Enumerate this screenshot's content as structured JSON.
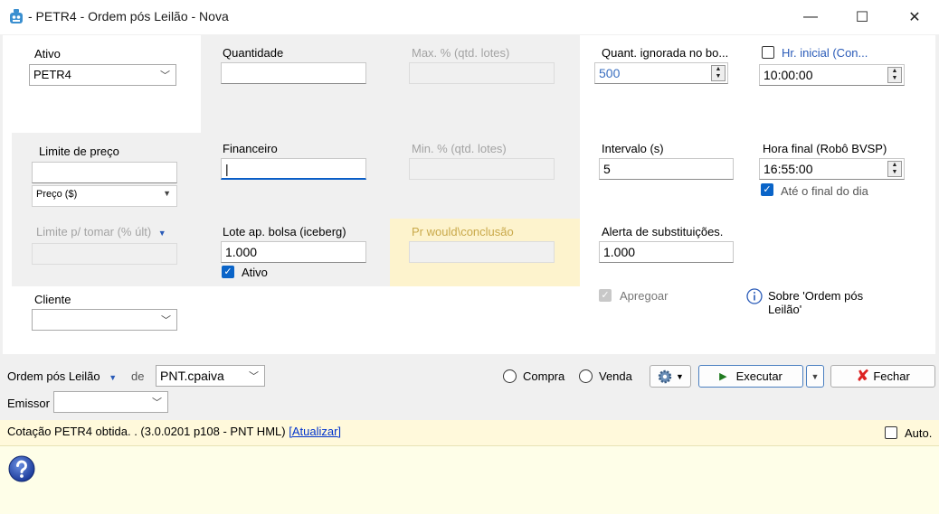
{
  "window": {
    "title": "- PETR4 - Ordem pós Leilão - Nova",
    "minimize_glyph": "—",
    "maximize_glyph": "☐",
    "close_glyph": "✕",
    "app_icon": "robot-icon"
  },
  "form": {
    "ativo": {
      "label": "Ativo",
      "value": "PETR4"
    },
    "quantidade": {
      "label": "Quantidade",
      "value": ""
    },
    "max_pct": {
      "label": "Max. % (qtd. lotes)",
      "value": ""
    },
    "quant_ignorada": {
      "label": "Quant. ignorada no bo...",
      "value": "500"
    },
    "hr_inicial": {
      "label": "Hr. inicial (Con...",
      "value": "10:00:00",
      "checked": false
    },
    "limite_preco": {
      "label": "Limite de preço",
      "value": "",
      "type_value": "Preço ($)"
    },
    "financeiro": {
      "label": "Financeiro",
      "value": "|"
    },
    "min_pct": {
      "label": "Min. % (qtd. lotes)",
      "value": ""
    },
    "intervalo": {
      "label": "Intervalo (s)",
      "value": "5"
    },
    "hora_final": {
      "label": "Hora final (Robô BVSP)",
      "value": "16:55:00"
    },
    "ate_final": {
      "label": "Até o final do dia",
      "checked": true
    },
    "limite_tomar": {
      "label": "Limite p/ tomar (% últ)",
      "value": ""
    },
    "lote_bolsa": {
      "label": "Lote ap. bolsa (iceberg)",
      "value": "1.000"
    },
    "ativo_check": {
      "label": "Ativo",
      "checked": true
    },
    "pr_would": {
      "label": "Pr would\\conclusão",
      "value": ""
    },
    "alerta": {
      "label": "Alerta de substituições.",
      "value": "1.000"
    },
    "apregoar": {
      "label": "Apregoar",
      "checked": true
    },
    "sobre": {
      "label": "Sobre 'Ordem pós Leilão'"
    },
    "cliente": {
      "label": "Cliente",
      "value": ""
    }
  },
  "bottom": {
    "tipo": "Ordem pós Leilão",
    "de_label": "de",
    "conta": "PNT.cpaiva",
    "compra": "Compra",
    "venda": "Venda",
    "executar": "Executar",
    "fechar": "Fechar",
    "emissor_label": "Emissor",
    "emissor_value": ""
  },
  "status": {
    "text": "Cotação PETR4 obtida. .  (3.0.0201 p108 - PNT HML)",
    "link": "[Atualizar]",
    "auto_label": "Auto.",
    "auto_checked": false
  },
  "colors": {
    "accent": "#0a64c8",
    "status_bg": "#fff9db",
    "highlight_bg": "#fdf3cd"
  }
}
